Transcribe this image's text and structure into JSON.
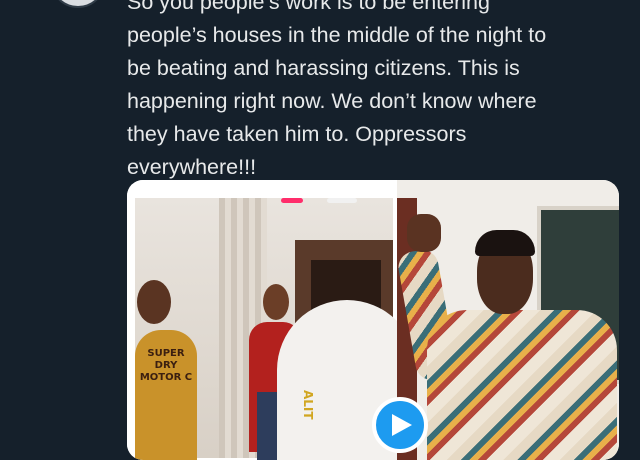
{
  "tweet": {
    "lines": [
      "So you people’s work is to be entering",
      "people’s houses in the middle of the night to",
      "be beating and harassing citizens. This is",
      "happening right now. We don’t know where",
      "they have taken him to. Oppressors",
      "everywhere!!!"
    ]
  },
  "media": {
    "shirt_text": "SUPER\nDRY\nMOTOR C",
    "back_text": "ALIT",
    "play_icon": "play-icon"
  },
  "colors": {
    "background": "#15202b",
    "text": "#e7e9ea",
    "accent": "#1d9bf0"
  }
}
